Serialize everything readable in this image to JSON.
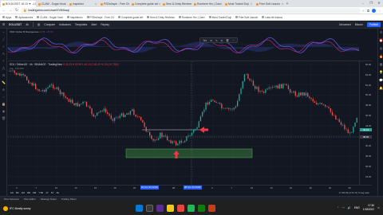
{
  "browser": {
    "tabs": [
      {
        "label": "BOLDUSDT 16.15 ▼ -1.88% B",
        "active": true
      },
      {
        "label": "CLAW - Sugar Hook",
        "active": false
      },
      {
        "label": "Inspektor",
        "active": false
      },
      {
        "label": "PSDsInspe - Free Ch",
        "active": false
      },
      {
        "label": "Complete guide wit",
        "active": false
      },
      {
        "label": "Sem & Dmty Reviews",
        "active": false
      },
      {
        "label": "Rumbere Hrc | Canv",
        "active": false
      },
      {
        "label": "Most Traded Doji",
        "active": false
      },
      {
        "label": "Free Soft Launch",
        "active": false
      }
    ],
    "new_tab": "+",
    "url": "tradingview.com/chart/0YlB5raq/",
    "window_controls": [
      "–",
      "❐",
      "✕"
    ]
  },
  "bookmarks": [
    "Apps",
    "Aplicaciones",
    "CLAW - Sugar Hook",
    "Inspektorio",
    "PSDsInspe - Free Ch",
    "Complete guide wit",
    "Sem & Dmty Reviews",
    "Rumbere Hrc | Canv",
    "Most Traded Doji",
    "Free Soft Launch",
    "Lista de lectura"
  ],
  "tv_toolbar": {
    "symbol": "SOLUSDT",
    "interval": "4h",
    "items": [
      "Compare",
      "Indicators",
      "Templates",
      "Alert",
      "Replay"
    ],
    "right_items": [
      "Unnamed",
      "Bitcoin"
    ],
    "publish": "Publish"
  },
  "indicator": {
    "legend": "VMC Cipher B Divergences",
    "val1": "-0.71",
    "val2": "+35.95",
    "floating_toolbar": [
      "Yes",
      "⚙",
      "✎",
      "⧉",
      "🗑",
      "···"
    ]
  },
  "main_legend": {
    "title": "SOL / TetherUS · 4h · BINANCE · TradingView",
    "ohlc": "O 40.13  H 40.90  L 40.10  C 40.43  +0.30 (+0.75%)",
    "sub": "Vol · 133.08K"
  },
  "price_ticks": [
    "56.00",
    "54.00",
    "52.00",
    "50.00",
    "48.00",
    "46.00",
    "44.00",
    "42.00",
    "40.00",
    "38.00",
    "36.00",
    "34.00"
  ],
  "price_tags": {
    "current": "40.43",
    "crosshair": "38.30"
  },
  "time_ticks": [
    "4",
    "7",
    "10",
    "13",
    "16",
    "19",
    "22",
    "25",
    "28",
    "Jul",
    "4",
    "7",
    "10",
    "13",
    "16",
    "19",
    "22",
    "25"
  ],
  "time_tags": {
    "left": "22 Jun '21  12:00",
    "right": "28 Jun '21  04:00"
  },
  "range_bar": {
    "ranges": [
      "1D",
      "5D",
      "1M",
      "3M",
      "6M",
      "YTD",
      "1Y",
      "5Y",
      "All"
    ],
    "right": "17:36:09 (UTC-5)   %   log   auto"
  },
  "bottom_panel": [
    "Pine Screener",
    "Pine Editor",
    "Strategy Tester",
    "Trading Panel"
  ],
  "taskbar": {
    "weather": "5°C  Mostly sunny",
    "time": "17:36",
    "date": "1/18/2022",
    "lang": "ENG"
  },
  "colors": {
    "up": "#26a69a",
    "down": "#ef5350",
    "zone": "#4caf50",
    "arrow": "#f23645",
    "accent": "#2962ff"
  }
}
